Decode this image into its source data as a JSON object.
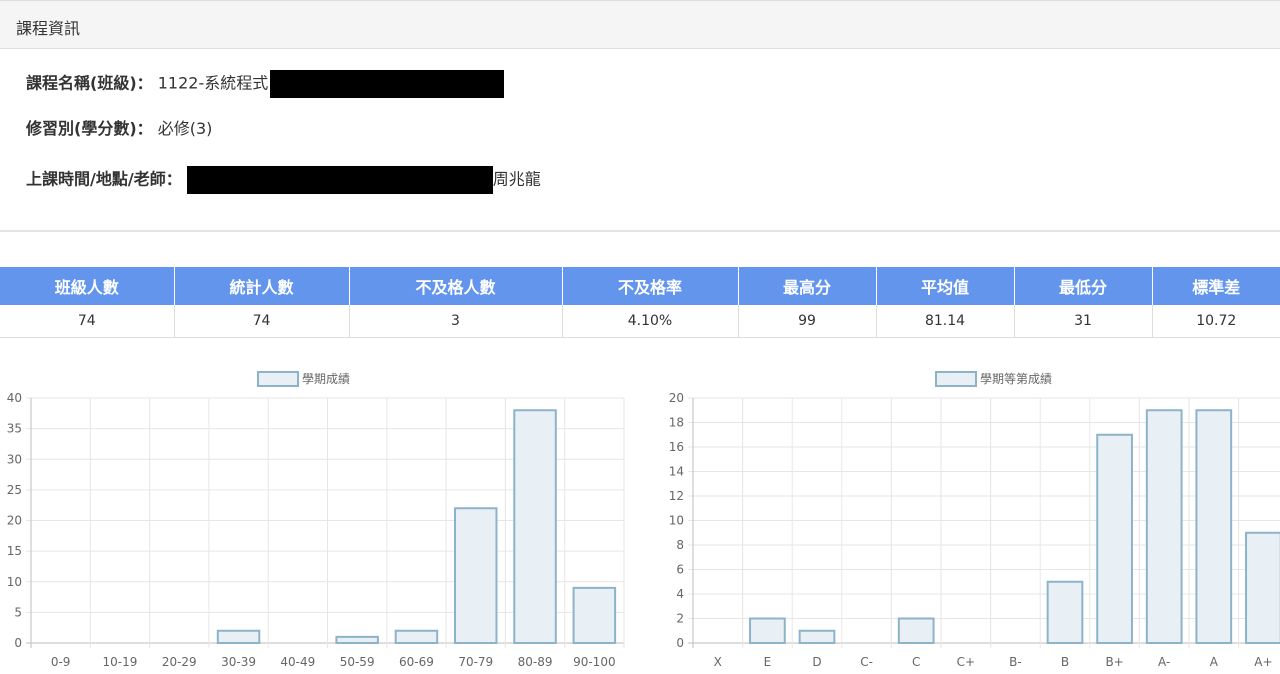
{
  "panel": {
    "title": "課程資訊"
  },
  "course": {
    "name_label": "課程名稱(班級)：",
    "name_value": "1122-系統程式",
    "elective_label": "修習別(學分數)：",
    "elective_value": "必修(3)",
    "schedule_label": "上課時間/地點/老師：",
    "schedule_value": "周兆龍"
  },
  "stats": {
    "headers": [
      "班級人數",
      "統計人數",
      "不及格人數",
      "不及格率",
      "最高分",
      "平均值",
      "最低分",
      "標準差"
    ],
    "values": [
      "74",
      "74",
      "3",
      "4.10%",
      "99",
      "81.14",
      "31",
      "10.72"
    ]
  },
  "colors": {
    "header_bg": "#6395ec",
    "bar_fill": "#e8f0f5",
    "bar_stroke": "#8db3c9"
  },
  "chart_data": [
    {
      "type": "bar",
      "legend": "學期成績",
      "categories": [
        "0-9",
        "10-19",
        "20-29",
        "30-39",
        "40-49",
        "50-59",
        "60-69",
        "70-79",
        "80-89",
        "90-100"
      ],
      "values": [
        0,
        0,
        0,
        2,
        0,
        1,
        2,
        22,
        38,
        9
      ],
      "ylim": [
        0,
        40
      ],
      "yticks": [
        0,
        5,
        10,
        15,
        20,
        25,
        30,
        35,
        40
      ],
      "grid": true,
      "legend_position": "top"
    },
    {
      "type": "bar",
      "legend": "學期等第成績",
      "categories": [
        "X",
        "E",
        "D",
        "C-",
        "C",
        "C+",
        "B-",
        "B",
        "B+",
        "A-",
        "A",
        "A+"
      ],
      "values": [
        0,
        2,
        1,
        0,
        2,
        0,
        0,
        5,
        17,
        19,
        19,
        9
      ],
      "ylim": [
        0,
        20
      ],
      "yticks": [
        0,
        2,
        4,
        6,
        8,
        10,
        12,
        14,
        16,
        18,
        20
      ],
      "grid": true,
      "legend_position": "top"
    }
  ]
}
